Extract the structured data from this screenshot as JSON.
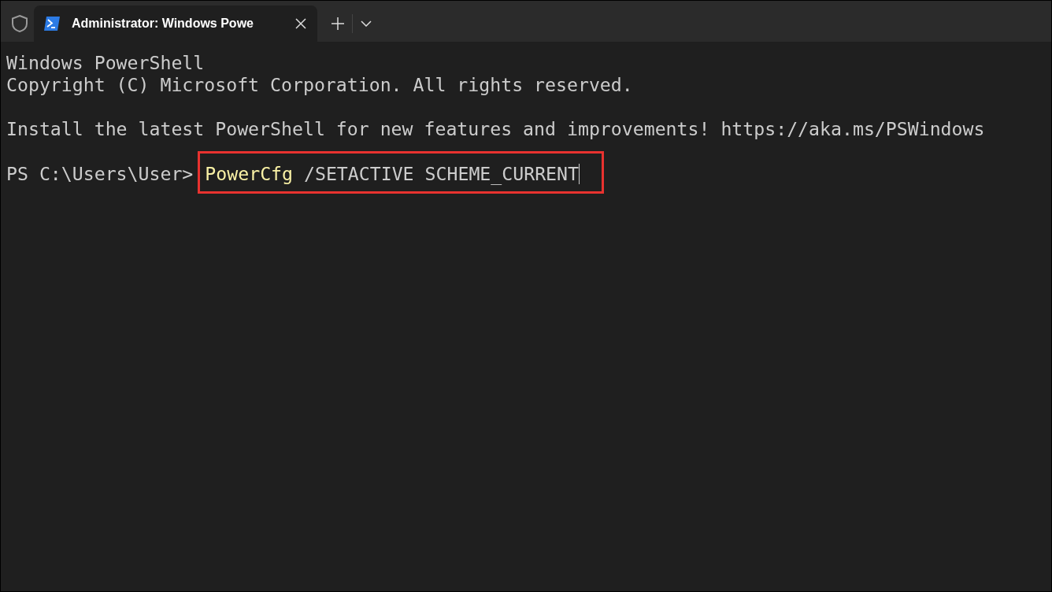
{
  "tabs": [
    {
      "title": "Administrator: Windows Powe",
      "selected": true
    }
  ],
  "output_paragraphs": [
    [
      "Windows PowerShell",
      "Copyright (C) Microsoft Corporation. All rights reserved."
    ],
    [
      "Install the latest PowerShell for new features and improvements! https://aka.ms/PSWindows"
    ]
  ],
  "prompt": "PS C:\\Users\\User>",
  "command": {
    "name": "PowerCfg",
    "arguments": "/SETACTIVE SCHEME_CURRENT",
    "highlighted": true
  }
}
